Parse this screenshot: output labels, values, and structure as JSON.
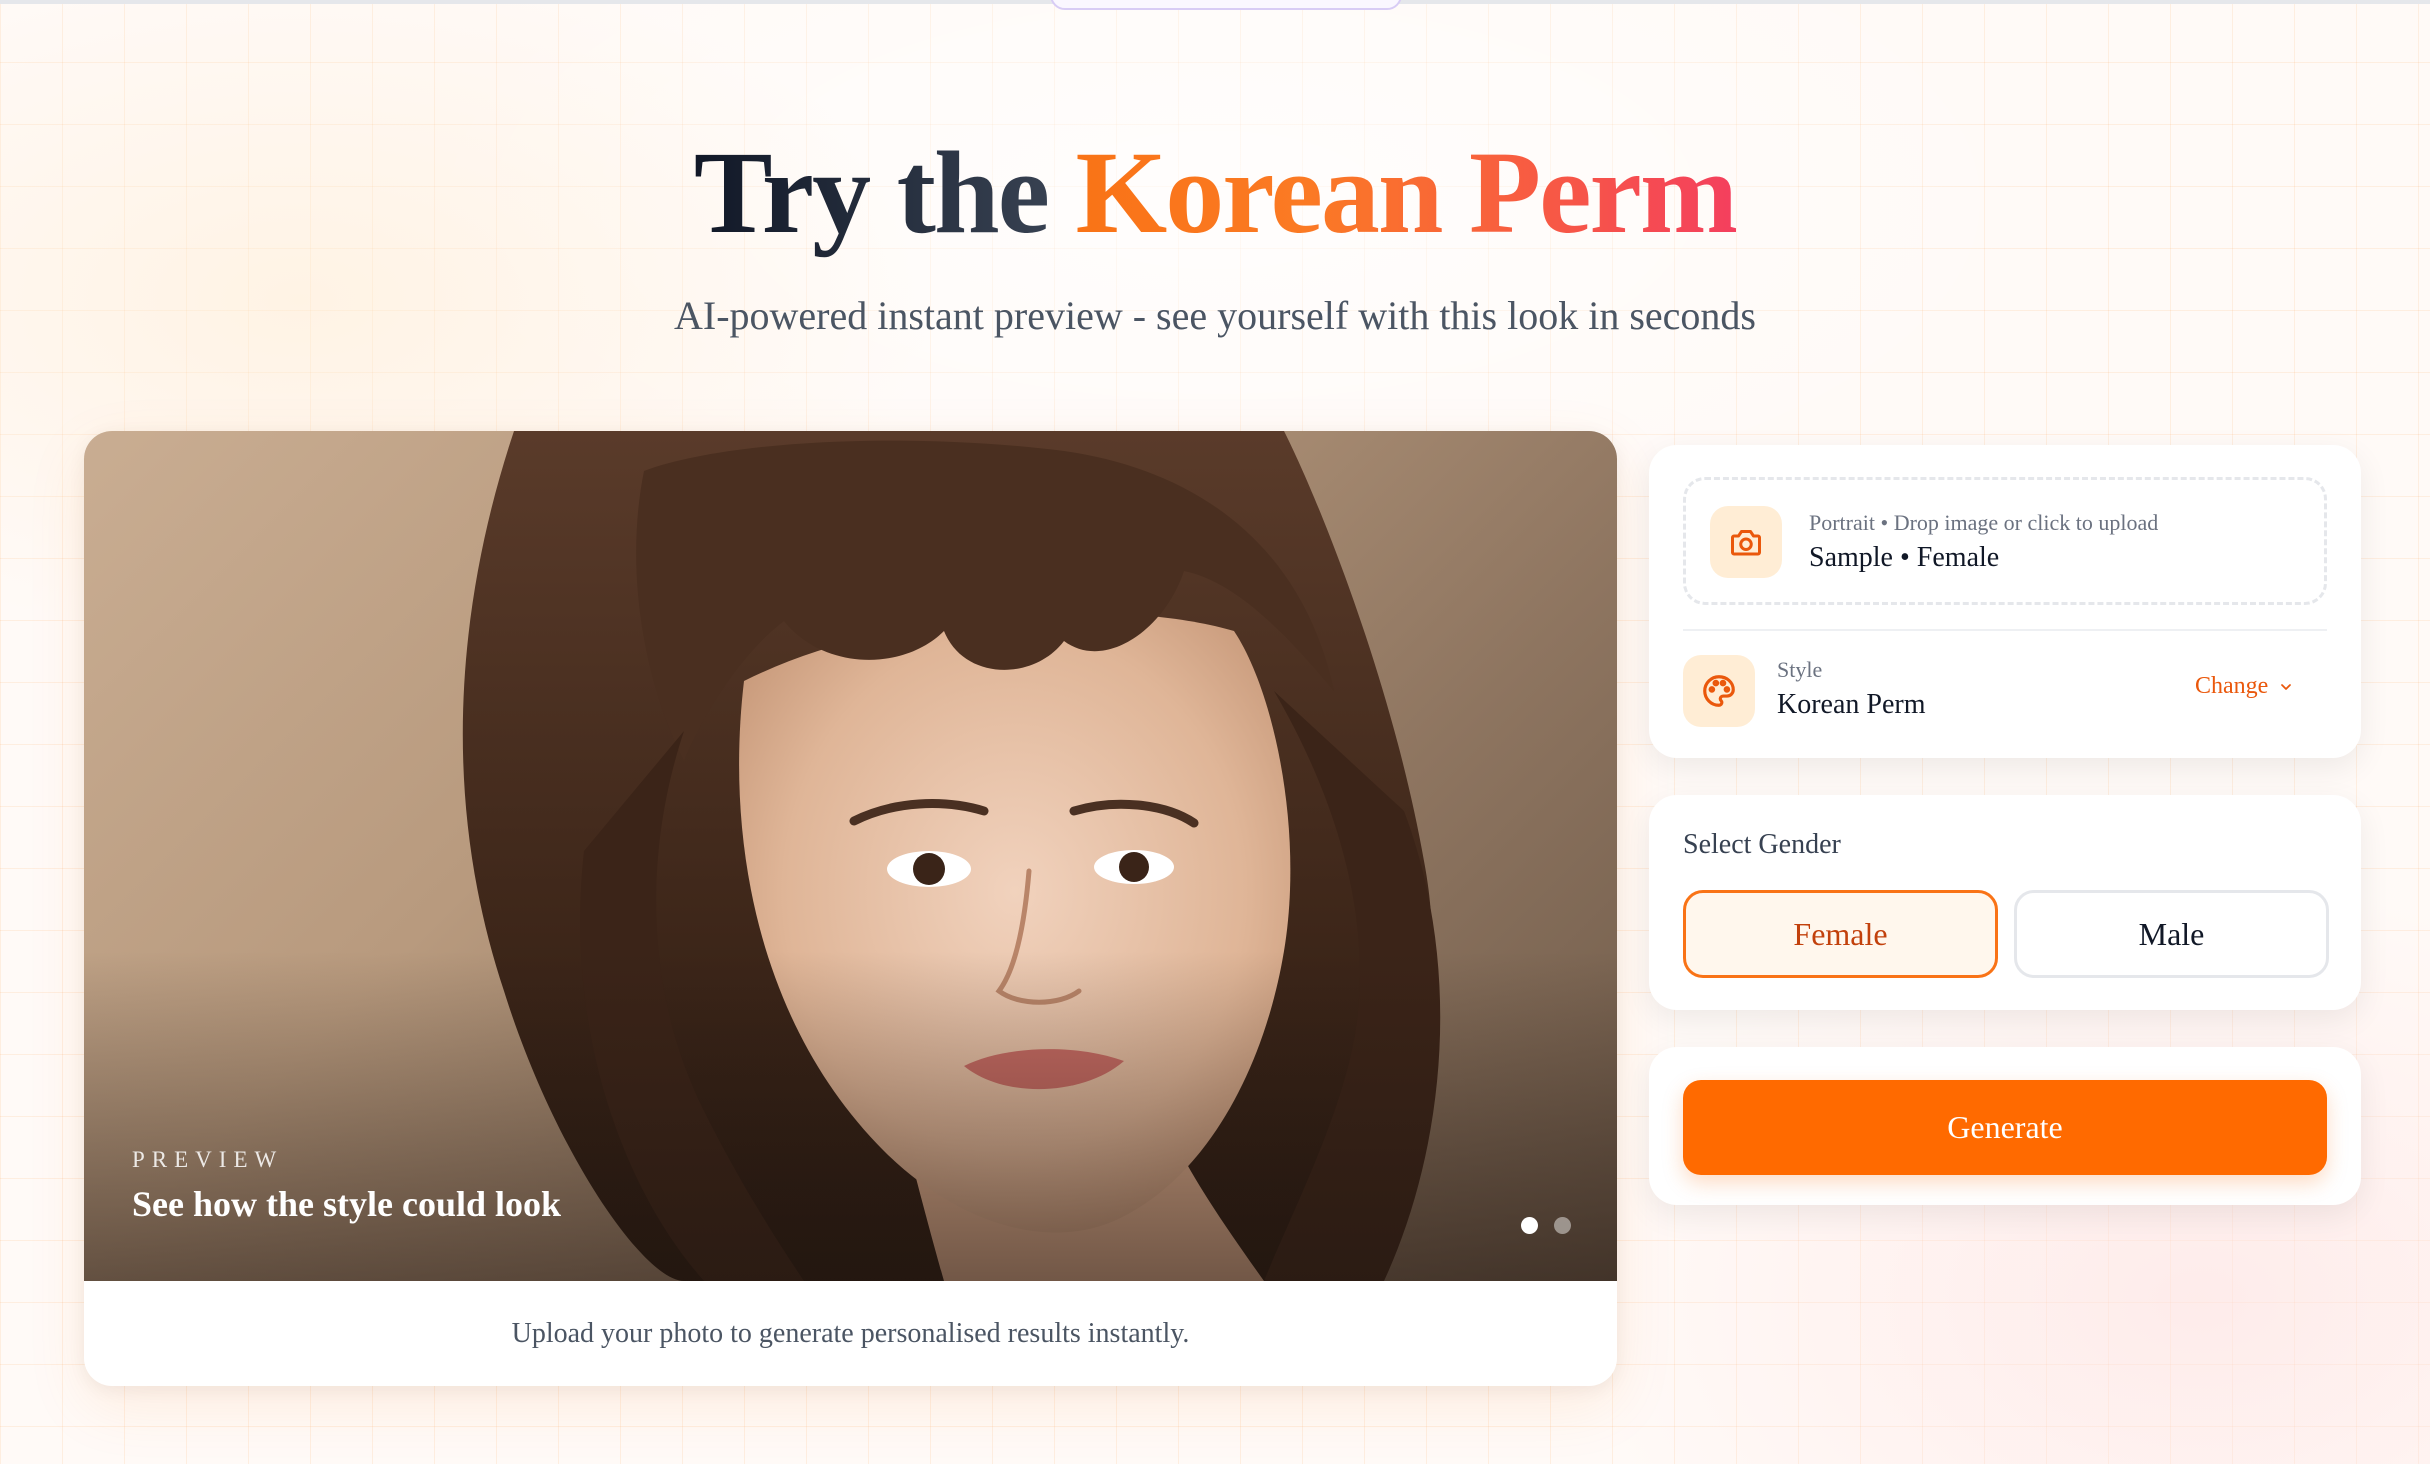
{
  "hero": {
    "title_part1": "Try the",
    "title_part2": "Korean Perm",
    "subtitle": "AI-powered instant preview - see yourself with this look in seconds"
  },
  "preview": {
    "eyebrow": "PREVIEW",
    "title": "See how the style could look",
    "caption": "Upload your photo to generate personalised results instantly.",
    "slides": 2,
    "active_slide": 1
  },
  "upload": {
    "hint": "Portrait • Drop image or click to upload",
    "current": "Sample • Female",
    "icon": "camera-icon"
  },
  "style": {
    "label": "Style",
    "value": "Korean Perm",
    "change_label": "Change",
    "icon": "palette-icon"
  },
  "gender": {
    "label": "Select Gender",
    "options": [
      "Female",
      "Male"
    ],
    "selected": "Female"
  },
  "generate": {
    "label": "Generate"
  },
  "colors": {
    "accent": "#ff6a00",
    "accent_soft": "#ffedd5",
    "title_gradient_start": "#f97316",
    "title_gradient_end": "#f43f5e"
  }
}
